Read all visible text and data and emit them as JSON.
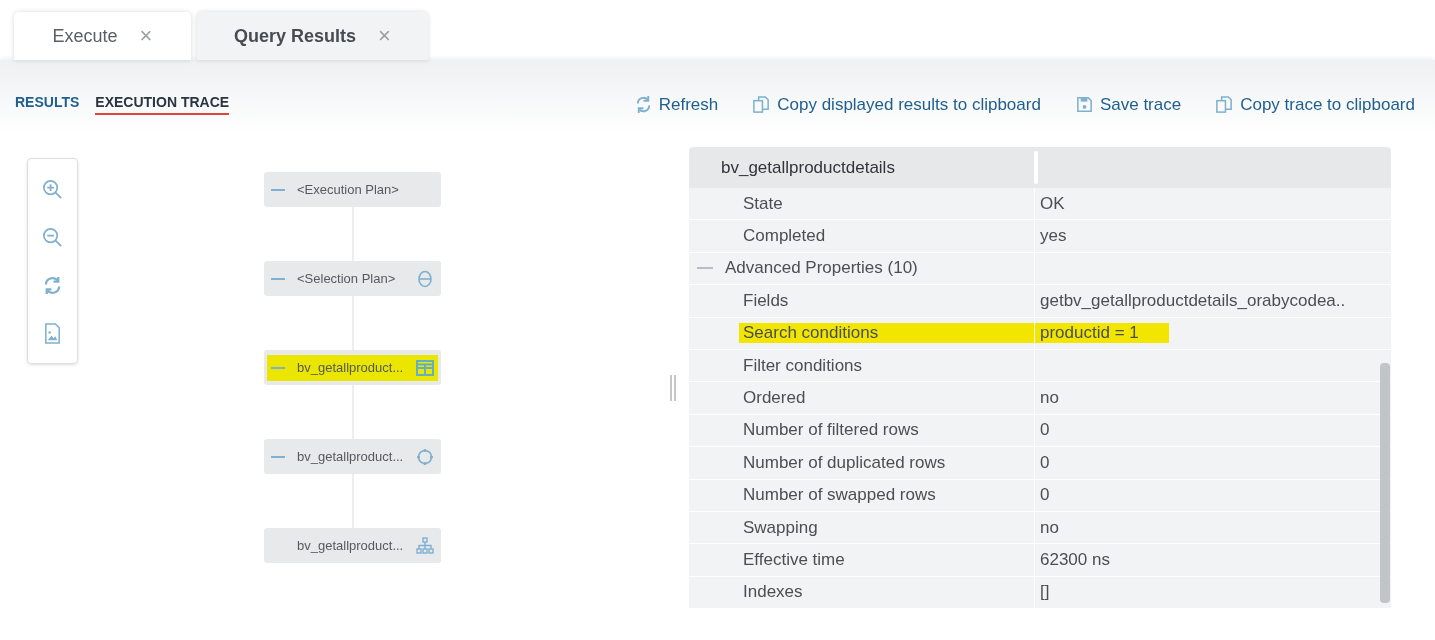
{
  "tabs": [
    {
      "label": "Execute",
      "close": "×",
      "selected": false
    },
    {
      "label": "Query Results",
      "close": "×",
      "selected": true
    }
  ],
  "view_tabs": [
    {
      "label": "RESULTS",
      "selected": false
    },
    {
      "label": "EXECUTION TRACE",
      "selected": true
    }
  ],
  "actions": [
    {
      "kind": "refresh",
      "label": "Refresh"
    },
    {
      "kind": "copy",
      "label": "Copy displayed results to clipboard"
    },
    {
      "kind": "save",
      "label": "Save trace"
    },
    {
      "kind": "copy",
      "label": "Copy trace to clipboard"
    }
  ],
  "zoom_tools": [
    {
      "kind": "zoom-in"
    },
    {
      "kind": "zoom-out"
    },
    {
      "kind": "refresh"
    },
    {
      "kind": "export"
    }
  ],
  "plan_nodes": [
    {
      "label": "<Execution Plan>",
      "collapsible": true,
      "kind": "root",
      "highlighted": false
    },
    {
      "label": "<Selection Plan>",
      "collapsible": true,
      "kind": "selection",
      "highlighted": false
    },
    {
      "label": "bv_getallproduct...",
      "collapsible": true,
      "kind": "table",
      "highlighted": true
    },
    {
      "label": "bv_getallproduct...",
      "collapsible": true,
      "kind": "circle",
      "highlighted": false
    },
    {
      "label": "bv_getallproduct...",
      "collapsible": false,
      "kind": "tree",
      "highlighted": false
    }
  ],
  "properties": {
    "title": "bv_getallproductdetails",
    "rows": [
      {
        "kind": "prop",
        "name": "State",
        "value": "OK",
        "highlighted": false
      },
      {
        "kind": "prop",
        "name": "Completed",
        "value": "yes",
        "highlighted": false
      },
      {
        "kind": "group",
        "name": "Advanced Properties (10)",
        "highlighted": false
      },
      {
        "kind": "prop",
        "name": "Fields",
        "value": "getbv_getallproductdetails_orabycodea..",
        "highlighted": false
      },
      {
        "kind": "prop",
        "name": "Search conditions",
        "value": "productid = 1",
        "highlighted": true
      },
      {
        "kind": "prop",
        "name": "Filter conditions",
        "highlighted": false
      },
      {
        "kind": "prop",
        "name": "Ordered",
        "value": "no",
        "highlighted": false
      },
      {
        "kind": "prop",
        "name": "Number of filtered rows",
        "value": "0",
        "highlighted": false
      },
      {
        "kind": "prop",
        "name": "Number of duplicated rows",
        "value": "0",
        "highlighted": false
      },
      {
        "kind": "prop",
        "name": "Number of swapped rows",
        "value": "0",
        "highlighted": false
      },
      {
        "kind": "prop",
        "name": "Swapping",
        "value": "no",
        "highlighted": false
      },
      {
        "kind": "prop",
        "name": "Effective time",
        "value": "62300 ns",
        "highlighted": false
      },
      {
        "kind": "prop",
        "name": "Indexes",
        "value": "[]",
        "highlighted": false
      }
    ]
  }
}
